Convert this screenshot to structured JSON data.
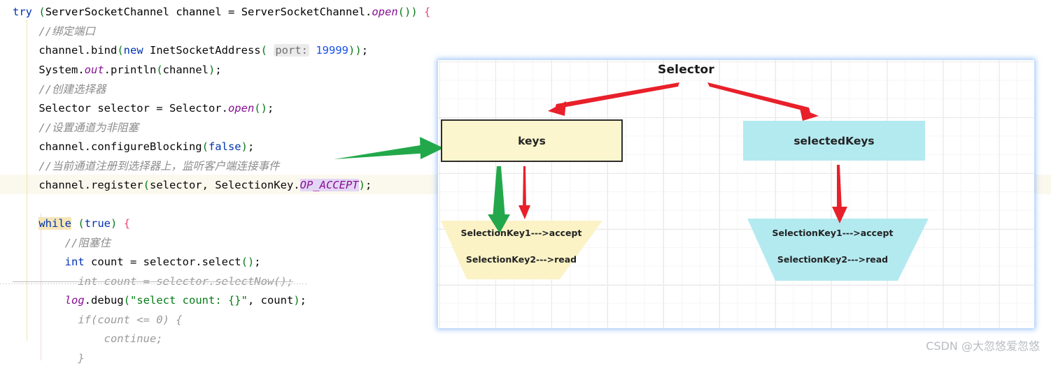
{
  "editor": {
    "lines": [
      {
        "indent": 0,
        "highlight": false,
        "text": "try (ServerSocketChannel channel = ServerSocketChannel.open()) {"
      },
      {
        "indent": 1,
        "highlight": false,
        "text": "//绑定端口"
      },
      {
        "indent": 1,
        "highlight": false,
        "text": "channel.bind(new InetSocketAddress( port: 19999));"
      },
      {
        "indent": 1,
        "highlight": false,
        "text": "System.out.println(channel);"
      },
      {
        "indent": 1,
        "highlight": false,
        "text": "//创建选择器"
      },
      {
        "indent": 1,
        "highlight": false,
        "text": "Selector selector = Selector.open();"
      },
      {
        "indent": 1,
        "highlight": false,
        "text": "//设置通道为非阻塞"
      },
      {
        "indent": 1,
        "highlight": false,
        "text": "channel.configureBlocking(false);"
      },
      {
        "indent": 1,
        "highlight": false,
        "text": "//当前通道注册到选择器上，监听客户端连接事件"
      },
      {
        "indent": 1,
        "highlight": true,
        "text": "channel.register(selector, SelectionKey.OP_ACCEPT);"
      },
      {
        "indent": 1,
        "highlight": false,
        "text": ""
      },
      {
        "indent": 1,
        "highlight": false,
        "text": "while (true) {"
      },
      {
        "indent": 2,
        "highlight": false,
        "text": "//阻塞住"
      },
      {
        "indent": 2,
        "highlight": false,
        "text": "int count = selector.select();"
      },
      {
        "indent": 2,
        "highlight": false,
        "text": "int count = selector.selectNow();"
      },
      {
        "indent": 2,
        "highlight": false,
        "text": "log.debug(\"select count: {}\", count);"
      },
      {
        "indent": 2,
        "highlight": false,
        "text": "if(count <= 0) {"
      },
      {
        "indent": 3,
        "highlight": false,
        "text": "continue;"
      },
      {
        "indent": 2,
        "highlight": false,
        "text": "}"
      }
    ],
    "parameter_hint": "port:",
    "port_value": "19999"
  },
  "diagram": {
    "title": "Selector",
    "keys_label": "keys",
    "selected_keys_label": "selectedKeys",
    "keys_trapezoid": {
      "line1": "SelectionKey1--->accept",
      "line2": "SelectionKey2--->read"
    },
    "selected_trapezoid": {
      "line1": "SelectionKey1--->accept",
      "line2": "SelectionKey2--->read"
    },
    "colors": {
      "keys_fill": "#fbf6cd",
      "keys_border": "#2e2e2e",
      "selected_fill": "#b3eaf0",
      "red_arrow": "#e8202a",
      "green_arrow": "#22a84a",
      "grid_line": "#eaeaea",
      "panel_glow": "#5096f0"
    },
    "arrows": [
      {
        "name": "selector-to-keys",
        "color": "#e8202a"
      },
      {
        "name": "selector-to-selectedkeys",
        "color": "#e8202a"
      },
      {
        "name": "keys-to-trapezoid-green",
        "color": "#22a84a"
      },
      {
        "name": "keys-to-trapezoid-red",
        "color": "#e8202a"
      },
      {
        "name": "selectedkeys-to-trapezoid-red",
        "color": "#e8202a"
      },
      {
        "name": "register-to-keys-green",
        "color": "#22a84a"
      }
    ]
  },
  "watermark": "CSDN @大忽悠爱忽悠"
}
